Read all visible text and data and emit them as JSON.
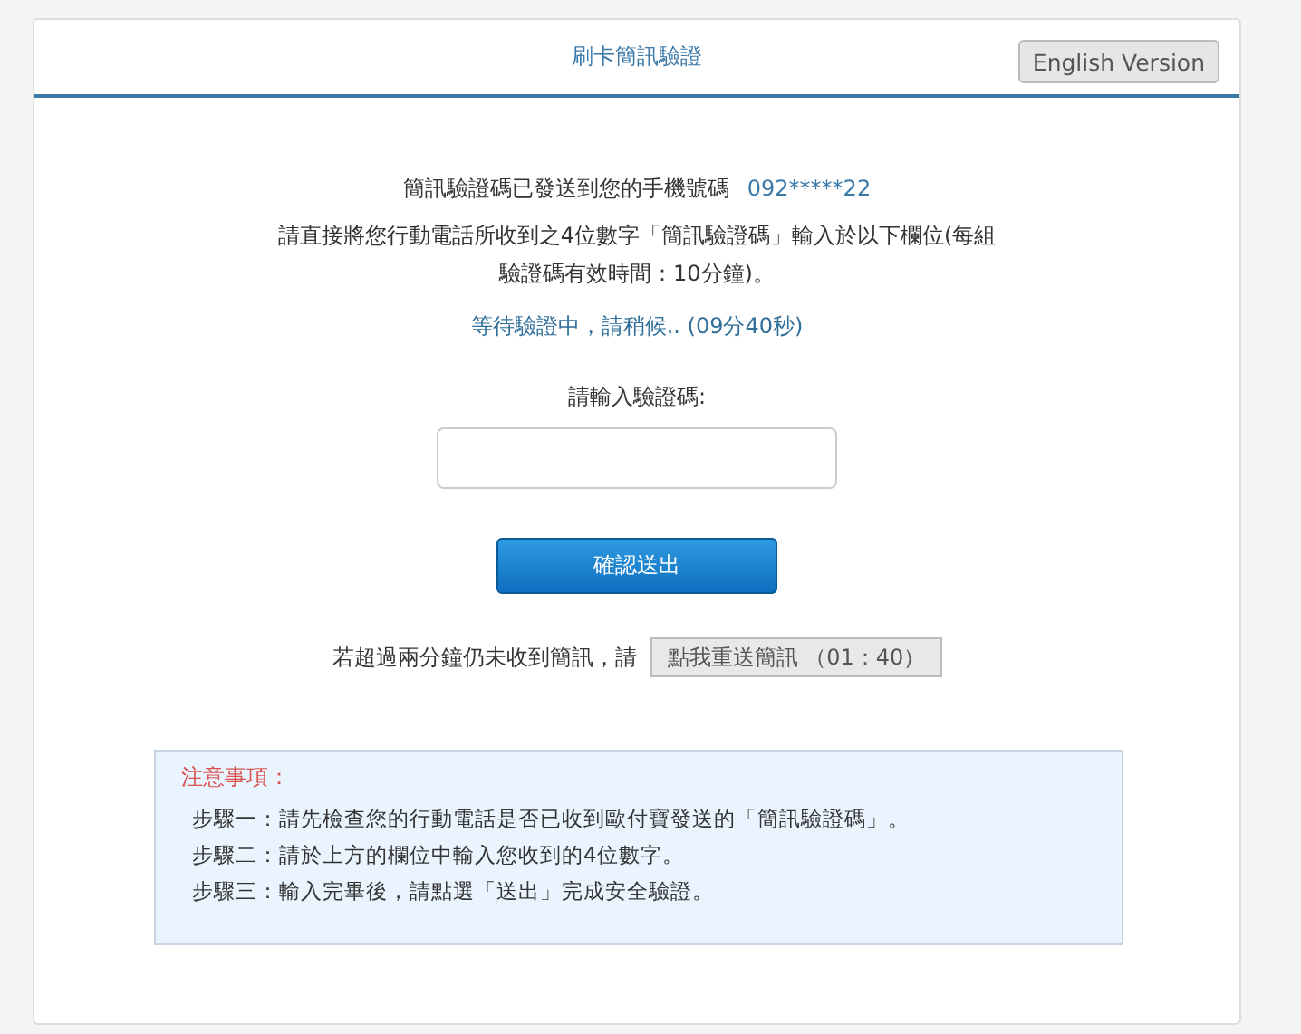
{
  "header": {
    "title": "刷卡簡訊驗證",
    "language_button": "English Version"
  },
  "message": {
    "sent_text": "簡訊驗證碼已發送到您的手機號碼",
    "phone": "092*****22",
    "instruction": "請直接將您行動電話所收到之4位數字「簡訊驗證碼」輸入於以下欄位(每組驗證碼有效時間：10分鐘)。",
    "waiting": "等待驗證中，請稍候.. (09分40秒)"
  },
  "form": {
    "label": "請輸入驗證碼:",
    "submit": "確認送出"
  },
  "resend": {
    "prompt": "若超過兩分鐘仍未收到簡訊，請",
    "button": "點我重送簡訊 （01：40）",
    "disabled": true
  },
  "notice": {
    "title": "注意事項：",
    "steps": [
      "步驟一：請先檢查您的行動電話是否已收到歐付寶發送的「簡訊驗證碼」。",
      "步驟二：請於上方的欄位中輸入您收到的4位數字。",
      "步驟三：輸入完畢後，請點選「送出」完成安全驗證。"
    ]
  }
}
